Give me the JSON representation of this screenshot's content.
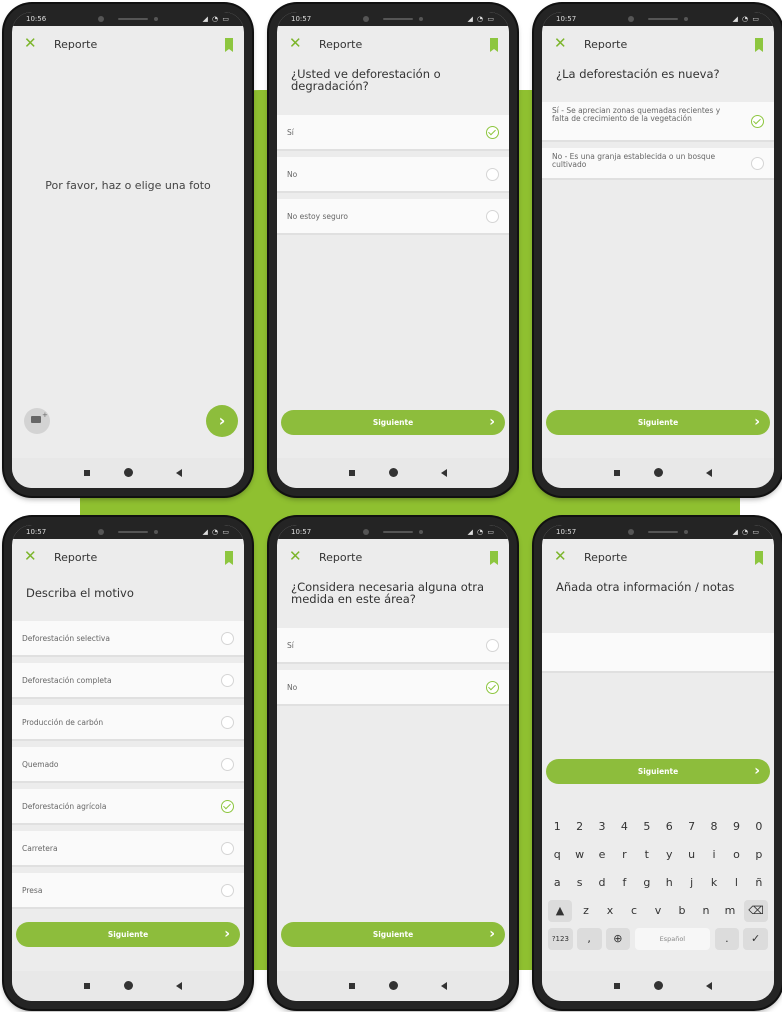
{
  "theme": {
    "accent": "#8dbd3c",
    "background_shape": "#8fc030"
  },
  "screens": [
    {
      "time": "10:56",
      "app_title": "Reporte",
      "message": "Por favor, haz o elige una foto"
    },
    {
      "time": "10:57",
      "app_title": "Reporte",
      "question": "¿Usted ve deforestación o degradación?",
      "options": [
        {
          "label": "Sí",
          "selected": true
        },
        {
          "label": "No",
          "selected": false
        },
        {
          "label": "No estoy seguro",
          "selected": false
        }
      ],
      "next_label": "Siguiente"
    },
    {
      "time": "10:57",
      "app_title": "Reporte",
      "question": "¿La deforestación es nueva?",
      "options": [
        {
          "label": "Sí - Se aprecian zonas quemadas recientes y falta de crecimiento de la vegetación",
          "selected": true
        },
        {
          "label": "No - Es una granja establecida o un bosque cultivado",
          "selected": false
        }
      ],
      "next_label": "Siguiente"
    },
    {
      "time": "10:57",
      "app_title": "Reporte",
      "question": "Describa el motivo",
      "options": [
        {
          "label": "Deforestación selectiva",
          "selected": false
        },
        {
          "label": "Deforestación completa",
          "selected": false
        },
        {
          "label": "Producción de carbón",
          "selected": false
        },
        {
          "label": "Quemado",
          "selected": false
        },
        {
          "label": "Deforestación agrícola",
          "selected": true
        },
        {
          "label": "Carretera",
          "selected": false
        },
        {
          "label": "Presa",
          "selected": false
        }
      ],
      "next_label": "Siguiente"
    },
    {
      "time": "10:57",
      "app_title": "Reporte",
      "question": "¿Considera necesaria alguna otra medida en este área?",
      "options": [
        {
          "label": "Sí",
          "selected": false
        },
        {
          "label": "No",
          "selected": true
        }
      ],
      "next_label": "Siguiente"
    },
    {
      "time": "10:57",
      "app_title": "Reporte",
      "question": "Añada otra información / notas",
      "next_label": "Siguiente",
      "keyboard": {
        "row1": [
          "1",
          "2",
          "3",
          "4",
          "5",
          "6",
          "7",
          "8",
          "9",
          "0"
        ],
        "row2": [
          "q",
          "w",
          "e",
          "r",
          "t",
          "y",
          "u",
          "i",
          "o",
          "p"
        ],
        "row3": [
          "a",
          "s",
          "d",
          "f",
          "g",
          "h",
          "j",
          "k",
          "l",
          "ñ"
        ],
        "row4": [
          "z",
          "x",
          "c",
          "v",
          "b",
          "n",
          "m"
        ],
        "symbols_key": "?123",
        "comma_key": ",",
        "space_label": "Español",
        "period_key": "."
      }
    }
  ]
}
